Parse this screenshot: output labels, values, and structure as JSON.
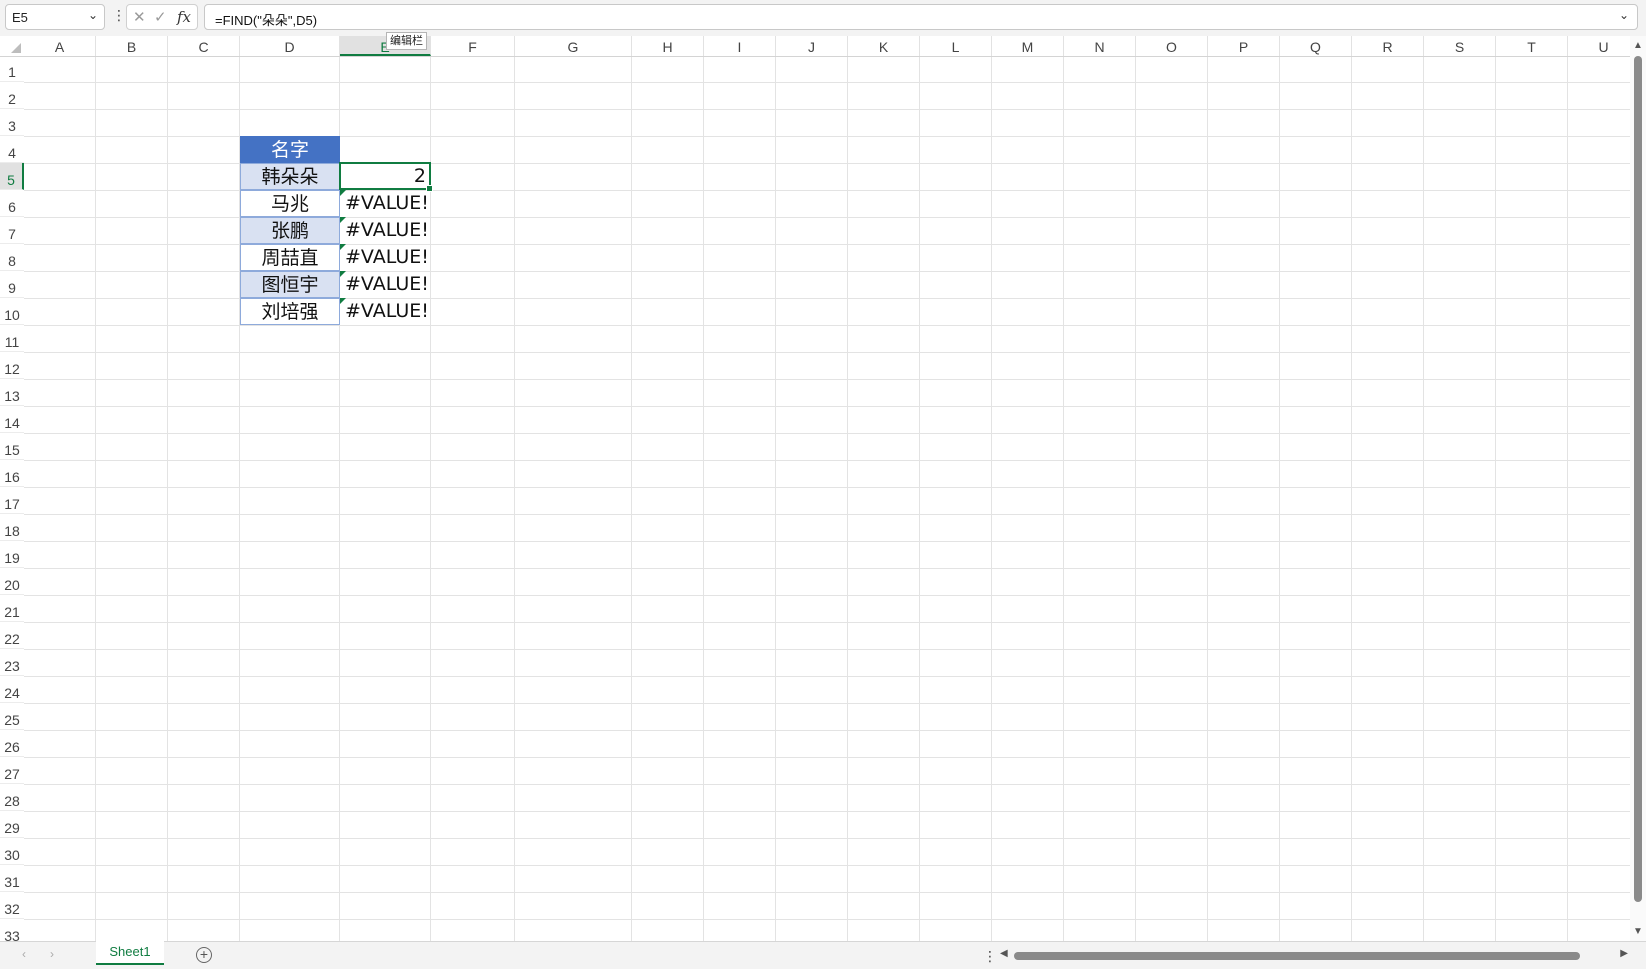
{
  "formula_bar": {
    "name_box": "E5",
    "cancel_icon": "close-icon",
    "enter_icon": "check-icon",
    "fx_label": "fx",
    "formula": "=FIND(\"朵朵\",D5)",
    "tooltip": "编辑栏"
  },
  "columns": [
    "A",
    "B",
    "C",
    "D",
    "E",
    "F",
    "G",
    "H",
    "I",
    "J",
    "K",
    "L",
    "M",
    "N",
    "O",
    "P",
    "Q",
    "R",
    "S",
    "T",
    "U"
  ],
  "active_column": "E",
  "rows": [
    "1",
    "2",
    "3",
    "4",
    "5",
    "6",
    "7",
    "8",
    "9",
    "10",
    "11",
    "12",
    "13",
    "14",
    "15",
    "16",
    "17",
    "18",
    "19",
    "20",
    "21",
    "22",
    "23",
    "24",
    "25",
    "26",
    "27",
    "28",
    "29",
    "30",
    "31",
    "32",
    "33"
  ],
  "active_row": "5",
  "table": {
    "header": "名字",
    "names": [
      "韩朵朵",
      "马兆",
      "张鹏",
      "周喆直",
      "图恒宇",
      "刘培强"
    ],
    "results": [
      "2",
      "#VALUE!",
      "#VALUE!",
      "#VALUE!",
      "#VALUE!",
      "#VALUE!"
    ]
  },
  "colors": {
    "header_fill": "#4472c4",
    "band_fill": "#d9e1f2",
    "accent_green": "#107c41"
  },
  "sheet_tabs": [
    "Sheet1"
  ],
  "add_sheet_icon": "plus-circle-icon"
}
